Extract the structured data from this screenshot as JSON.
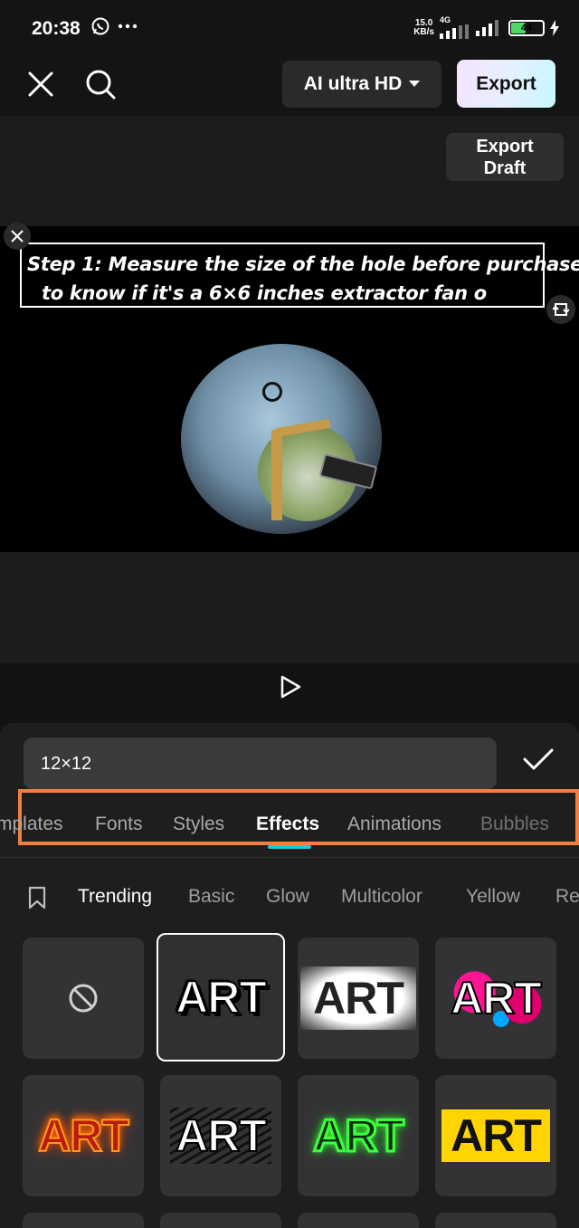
{
  "status": {
    "time": "20:38",
    "speed_value": "15.0",
    "speed_unit": "KB/s",
    "network": "4G",
    "battery": "44"
  },
  "toolbar": {
    "quality_label": "AI ultra HD",
    "export_label": "Export"
  },
  "preview": {
    "export_draft_line1": "Export",
    "export_draft_line2": "Draft",
    "caption_line1": "Step 1: Measure the size of the hole before purchase,",
    "caption_line2": "to know if it's a 6×6 inches extractor fan o"
  },
  "editor": {
    "input_value": "12×12"
  },
  "tabs": [
    {
      "label": "mplates"
    },
    {
      "label": "Fonts"
    },
    {
      "label": "Styles"
    },
    {
      "label": "Effects",
      "active": true
    },
    {
      "label": "Animations"
    },
    {
      "label": "Bubbles"
    }
  ],
  "categories": [
    {
      "label": "Trending",
      "active": true
    },
    {
      "label": "Basic"
    },
    {
      "label": "Glow"
    },
    {
      "label": "Multicolor"
    },
    {
      "label": "Yellow"
    },
    {
      "label": "Re"
    }
  ],
  "effects": [
    {
      "label": "",
      "icon": "none-icon"
    },
    {
      "label": "ART",
      "style": "outline",
      "selected": true
    },
    {
      "label": "ART",
      "style": "cloud"
    },
    {
      "label": "ART",
      "style": "splash"
    },
    {
      "label": "ART",
      "style": "fire"
    },
    {
      "label": "ART",
      "style": "scratch"
    },
    {
      "label": "ART",
      "style": "neon-green"
    },
    {
      "label": "ART",
      "style": "yellow-block"
    }
  ],
  "colors": {
    "accent": "#1fc9e0",
    "highlight": "#f08040"
  }
}
